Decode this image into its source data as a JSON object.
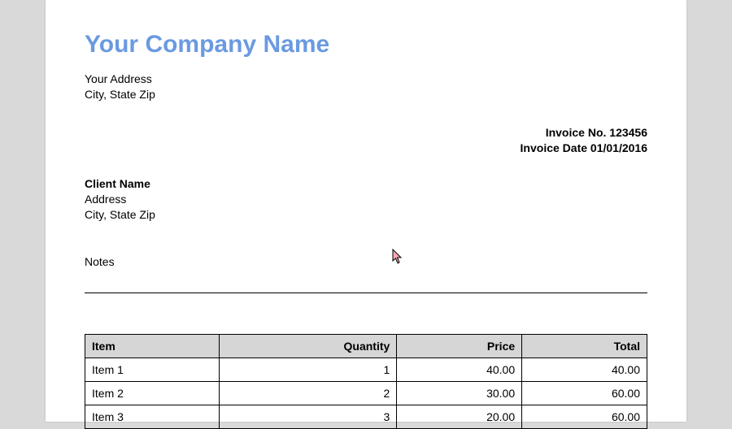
{
  "company": {
    "name": "Your Company Name",
    "address_line1": "Your Address",
    "address_line2": "City, State Zip"
  },
  "invoice": {
    "number_label": "Invoice No.",
    "number_value": "123456",
    "date_label": "Invoice Date",
    "date_value": "01/01/2016"
  },
  "client": {
    "name": "Client Name",
    "address_line1": "Address",
    "address_line2": "City, State Zip"
  },
  "notes": {
    "label": "Notes"
  },
  "table": {
    "headers": {
      "item": "Item",
      "quantity": "Quantity",
      "price": "Price",
      "total": "Total"
    },
    "rows": [
      {
        "item": "Item 1",
        "quantity": "1",
        "price": "40.00",
        "total": "40.00"
      },
      {
        "item": "Item 2",
        "quantity": "2",
        "price": "30.00",
        "total": "60.00"
      },
      {
        "item": "Item 3",
        "quantity": "3",
        "price": "20.00",
        "total": "60.00"
      }
    ]
  }
}
